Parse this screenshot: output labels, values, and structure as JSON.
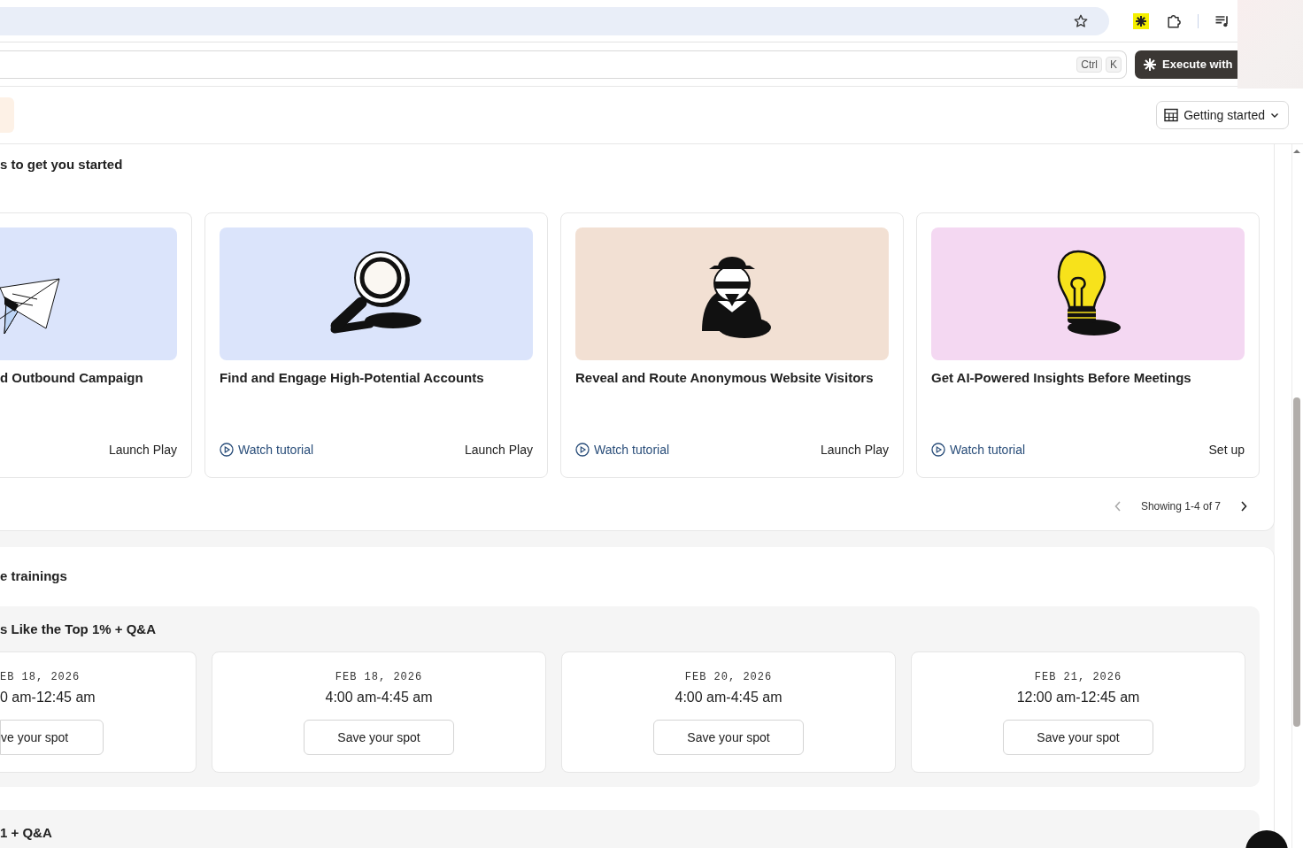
{
  "search": {
    "keys": [
      "Ctrl",
      "K"
    ]
  },
  "execute_button": {
    "label": "Execute with"
  },
  "toolbar": {
    "dropdown": {
      "label": "Getting started"
    }
  },
  "plays": {
    "title": "s to get you started",
    "cards": [
      {
        "kind": "plane",
        "color": "#dbe4fb",
        "title": "d Outbound Campaign",
        "action": "Launch Play"
      },
      {
        "kind": "magnifier",
        "color": "#dbe4fb",
        "title": "Find and Engage High-Potential Accounts",
        "tutorial": "Watch tutorial",
        "action": "Launch Play"
      },
      {
        "kind": "spy",
        "color": "#f2e0d3",
        "title": "Reveal and Route Anonymous Website Visitors",
        "tutorial": "Watch tutorial",
        "action": "Launch Play"
      },
      {
        "kind": "lightbulb",
        "color": "#f4d8f2",
        "title": "Get AI-Powered Insights Before Meetings",
        "tutorial": "Watch tutorial",
        "action": "Set up"
      }
    ],
    "pager": {
      "text": "Showing 1-4 of 7",
      "prev_disabled": true,
      "next_disabled": false
    }
  },
  "trainings": {
    "title": "e trainings",
    "sections": [
      {
        "title": "s Like the Top 1% + Q&A",
        "events": [
          {
            "date": "EB 18, 2026",
            "time": "0 am-12:45 am",
            "button": "ve your spot",
            "cut": true
          },
          {
            "date": "FEB 18, 2026",
            "time": "4:00 am-4:45 am",
            "button": "Save your spot",
            "cut": false
          },
          {
            "date": "FEB 20, 2026",
            "time": "4:00 am-4:45 am",
            "button": "Save your spot",
            "cut": false
          },
          {
            "date": "FEB 21, 2026",
            "time": "12:00 am-12:45 am",
            "button": "Save your spot",
            "cut": false
          }
        ]
      },
      {
        "title": "1 + Q&A"
      }
    ]
  }
}
